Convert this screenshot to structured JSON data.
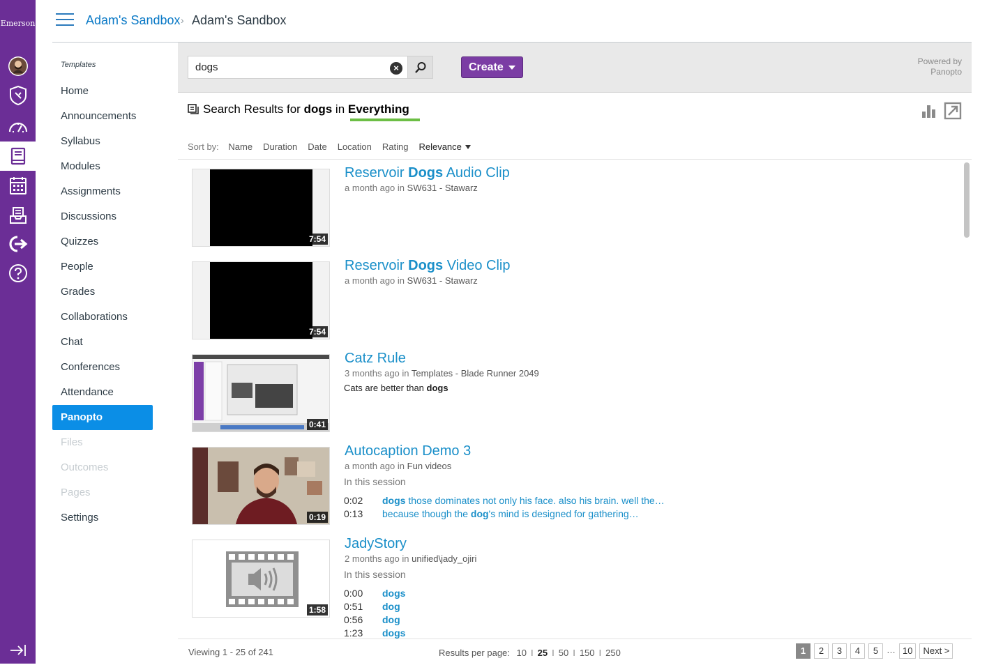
{
  "global_nav": {
    "logo": "Emerson",
    "items": [
      "account",
      "admin",
      "dashboard",
      "courses",
      "calendar",
      "inbox",
      "commons",
      "help"
    ],
    "collapse": "collapse-nav"
  },
  "header": {
    "breadcrumb": [
      "Adam's Sandbox",
      "Adam's Sandbox"
    ],
    "separator": "›"
  },
  "course_nav": {
    "section_label": "Templates",
    "items": [
      {
        "label": "Home",
        "state": "normal"
      },
      {
        "label": "Announcements",
        "state": "normal"
      },
      {
        "label": "Syllabus",
        "state": "normal"
      },
      {
        "label": "Modules",
        "state": "normal"
      },
      {
        "label": "Assignments",
        "state": "normal"
      },
      {
        "label": "Discussions",
        "state": "normal"
      },
      {
        "label": "Quizzes",
        "state": "normal"
      },
      {
        "label": "People",
        "state": "normal"
      },
      {
        "label": "Grades",
        "state": "normal"
      },
      {
        "label": "Collaborations",
        "state": "normal"
      },
      {
        "label": "Chat",
        "state": "normal"
      },
      {
        "label": "Conferences",
        "state": "normal"
      },
      {
        "label": "Attendance",
        "state": "normal"
      },
      {
        "label": "Panopto",
        "state": "active"
      },
      {
        "label": "Files",
        "state": "disabled"
      },
      {
        "label": "Outcomes",
        "state": "disabled"
      },
      {
        "label": "Pages",
        "state": "disabled"
      },
      {
        "label": "Settings",
        "state": "normal"
      }
    ]
  },
  "panopto": {
    "search": {
      "value": "dogs",
      "clear": "×"
    },
    "create_label": "Create",
    "powered_by": [
      "Powered by",
      "Panopto"
    ],
    "results_heading": {
      "prefix": "Search Results for",
      "query": "dogs",
      "mid": "in",
      "scope": "Everything"
    },
    "sort": {
      "label": "Sort by:",
      "options": [
        "Name",
        "Duration",
        "Date",
        "Location",
        "Rating"
      ],
      "selected": "Relevance"
    },
    "results": [
      {
        "title_pre": "Reservoir ",
        "title_hl": "Dogs",
        "title_post": " Audio Clip",
        "age": "a month ago",
        "in": "in",
        "folder": "SW631 - Stawarz",
        "duration": "7:54",
        "thumb": "black"
      },
      {
        "title_pre": "Reservoir ",
        "title_hl": "Dogs",
        "title_post": " Video Clip",
        "age": "a month ago",
        "in": "in",
        "folder": "SW631 - Stawarz",
        "duration": "7:54",
        "thumb": "black"
      },
      {
        "title_pre": "Catz Rule",
        "title_hl": "",
        "title_post": "",
        "age": "3 months ago",
        "in": "in",
        "folder": "Templates - Blade Runner 2049",
        "duration": "0:41",
        "thumb": "screen",
        "desc_pre": "Cats are better than ",
        "desc_hl": "dogs"
      },
      {
        "title_pre": "Autocaption Demo 3",
        "title_hl": "",
        "title_post": "",
        "age": "a month ago",
        "in": "in",
        "folder": "Fun videos",
        "duration": "0:19",
        "thumb": "person",
        "in_session": "In this session",
        "hits": [
          {
            "time": "0:02",
            "hl": "dogs",
            "post": " those dominates not only his face. also his brain. well the…",
            "pre": ""
          },
          {
            "time": "0:13",
            "pre": "because though the ",
            "hl": "dog",
            "post": "'s mind is designed for gathering…"
          }
        ]
      },
      {
        "title_pre": "JadyStory",
        "title_hl": "",
        "title_post": "",
        "age": "2 months ago",
        "in": "in",
        "folder": "unified\\jady_ojiri",
        "duration": "1:58",
        "thumb": "audio",
        "in_session": "In this session",
        "hits": [
          {
            "time": "0:00",
            "pre": "",
            "hl": "dogs",
            "post": ""
          },
          {
            "time": "0:51",
            "pre": "",
            "hl": "dog",
            "post": ""
          },
          {
            "time": "0:56",
            "pre": "",
            "hl": "dog",
            "post": ""
          },
          {
            "time": "1:23",
            "pre": "",
            "hl": "dogs",
            "post": ""
          }
        ]
      }
    ],
    "footer": {
      "viewing": "Viewing 1 - 25 of 241",
      "rpp_label": "Results per page:",
      "rpp_options": [
        "10",
        "25",
        "50",
        "150",
        "250"
      ],
      "rpp_selected": "25",
      "pages": [
        "1",
        "2",
        "3",
        "4",
        "5"
      ],
      "ellipsis": "…",
      "last_page": "10",
      "next": "Next >",
      "current_page": "1"
    }
  },
  "colors": {
    "global_nav": "#6b2e96",
    "link": "#0a79c6",
    "active_nav": "#0b8ee6",
    "create": "#7b3da4",
    "title": "#1a8fc9",
    "underline": "#6cbe45"
  }
}
